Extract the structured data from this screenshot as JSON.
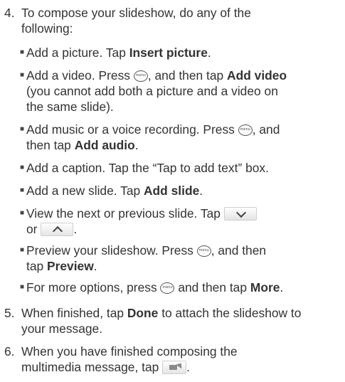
{
  "step4": {
    "number": "4.",
    "line1": "To compose your slideshow, do any of the",
    "line2": "following:"
  },
  "bullets": {
    "b1": {
      "t1": "Add a picture. Tap ",
      "b1": "Insert picture",
      "t2": "."
    },
    "b2": {
      "t1": "Add a video. Press ",
      "t2": ", and then tap ",
      "b1": "Add video",
      "l2": "(you cannot add both a picture and a video on",
      "l3": "the same slide)."
    },
    "b3": {
      "t1": "Add music or a voice recording. Press ",
      "t2": ", and",
      "l2a": "then tap ",
      "b1": "Add audio",
      "l2b": "."
    },
    "b4": {
      "t1": "Add a caption. Tap the “Tap to add text” box."
    },
    "b5": {
      "t1": "Add a new slide. Tap ",
      "b1": "Add slide",
      "t2": "."
    },
    "b6": {
      "t1": "View the next or previous slide. Tap",
      "l2a": "or",
      "l2b": "."
    },
    "b7": {
      "t1": "Preview your slideshow. Press ",
      "t2": ", and then",
      "l2a": "tap ",
      "b1": "Preview",
      "l2b": "."
    },
    "b8": {
      "t1": "For more options, press ",
      "t2": " and then tap ",
      "b1": "More",
      "t3": "."
    }
  },
  "step5": {
    "number": "5.",
    "t1": "When finished, tap ",
    "b1": "Done",
    "t2": " to attach the slideshow to",
    "l2": "your message."
  },
  "step6": {
    "number": "6.",
    "line1": "When you have finished composing the",
    "l2": "multimedia message, tap ",
    "l2end": "."
  },
  "icons": {
    "menu": "menu-key-icon",
    "next": "chevron-down-icon",
    "previous": "chevron-up-icon",
    "send": "send-icon"
  }
}
